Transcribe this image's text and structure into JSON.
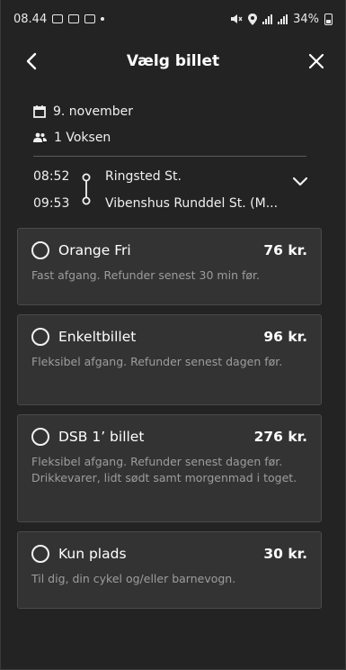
{
  "status_bar": {
    "time": "08.44",
    "battery": "34%"
  },
  "header": {
    "title": "Vælg billet"
  },
  "trip": {
    "date": "9. november",
    "passengers": "1 Voksen",
    "departure_time": "08:52",
    "departure_station": "Ringsted St.",
    "arrival_time": "09:53",
    "arrival_station": "Vibenshus Runddel St. (M..."
  },
  "tickets": [
    {
      "name": "Orange Fri",
      "price": "76 kr.",
      "description": "Fast afgang. Refunder senest 30 min før."
    },
    {
      "name": "Enkeltbillet",
      "price": "96 kr.",
      "description": "Fleksibel afgang. Refunder senest dagen før."
    },
    {
      "name": "DSB 1’ billet",
      "price": "276 kr.",
      "description": "Fleksibel afgang. Refunder senest dagen før. Drikkevarer, lidt sødt samt morgenmad i toget."
    },
    {
      "name": "Kun plads",
      "price": "30 kr.",
      "description": "Til dig, din cykel og/eller barnevogn."
    }
  ],
  "icons": {
    "back": "chevron-left-icon",
    "close": "close-icon",
    "calendar": "calendar-icon",
    "passengers": "people-icon",
    "expand": "chevron-down-icon"
  }
}
